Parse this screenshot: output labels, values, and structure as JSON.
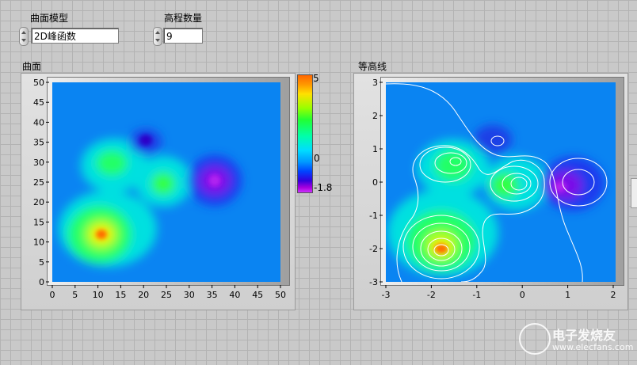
{
  "controls": {
    "surface_model": {
      "label": "曲面模型",
      "value": "2D峰函数"
    },
    "elevation_count": {
      "label": "高程数量",
      "value": "9"
    }
  },
  "graphs": {
    "surface": {
      "title": "曲面"
    },
    "contour": {
      "title": "等高线"
    }
  },
  "colorbar": {
    "max_label": "5",
    "mid_label": "0",
    "min_label": "-1.8"
  },
  "chart_data": [
    {
      "type": "heatmap",
      "title": "曲面",
      "xlabel": "",
      "ylabel": "",
      "xlim": [
        0,
        50
      ],
      "ylim": [
        0,
        50
      ],
      "x_ticks": [
        0,
        5,
        10,
        15,
        20,
        25,
        30,
        35,
        40,
        45,
        50
      ],
      "y_ticks": [
        0,
        5,
        10,
        15,
        20,
        25,
        30,
        35,
        40,
        45,
        50
      ],
      "zlim": [
        -1.8,
        5
      ],
      "features": [
        {
          "kind": "peak",
          "x": 11,
          "y": 12,
          "z": 5
        },
        {
          "kind": "peak",
          "x": 13,
          "y": 30,
          "z": 2
        },
        {
          "kind": "peak",
          "x": 25,
          "y": 25,
          "z": 2
        },
        {
          "kind": "valley",
          "x": 21,
          "y": 36,
          "z": -0.8
        },
        {
          "kind": "valley",
          "x": 36,
          "y": 26,
          "z": -1.8
        }
      ]
    },
    {
      "type": "heatmap",
      "title": "等高线",
      "xlabel": "",
      "ylabel": "",
      "xlim": [
        -3,
        2
      ],
      "ylim": [
        -3,
        3
      ],
      "x_ticks": [
        -3,
        -2,
        -1,
        0,
        1,
        2
      ],
      "y_ticks": [
        -3,
        -2,
        -1,
        0,
        1,
        2,
        3
      ],
      "contour_levels": 9,
      "features": [
        {
          "kind": "peak",
          "x": -1.8,
          "y": -2.0,
          "z": 5
        },
        {
          "kind": "peak",
          "x": -1.4,
          "y": 0.6,
          "z": 2
        },
        {
          "kind": "peak",
          "x": 0.0,
          "y": 0.0,
          "z": 2
        },
        {
          "kind": "valley",
          "x": -0.5,
          "y": 1.3,
          "z": -0.8
        },
        {
          "kind": "valley",
          "x": 1.2,
          "y": 0.0,
          "z": -1.8
        }
      ]
    }
  ],
  "watermark": {
    "line1": "电子发烧友",
    "line2": "www.elecfans.com"
  },
  "colors": {
    "panel_bg": "#c9c9c9",
    "plot_bg": "#0a7ff5",
    "contour_line": "#ffffff"
  }
}
